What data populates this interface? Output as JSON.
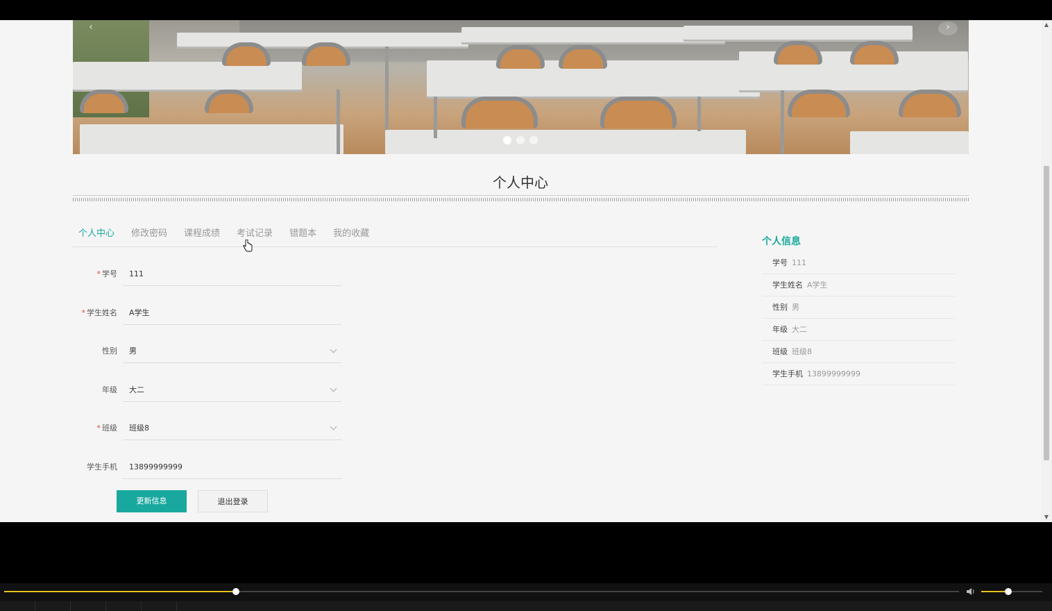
{
  "banner": {
    "prev_arrow": "‹",
    "next_arrow": "›",
    "dots": 3,
    "active_dot": 0
  },
  "page_title": "个人中心",
  "tabs": [
    {
      "label": "个人中心",
      "active": true
    },
    {
      "label": "修改密码",
      "active": false
    },
    {
      "label": "课程成绩",
      "active": false
    },
    {
      "label": "考试记录",
      "active": false
    },
    {
      "label": "错题本",
      "active": false
    },
    {
      "label": "我的收藏",
      "active": false
    }
  ],
  "form": {
    "student_id": {
      "label": "学号",
      "value": "111",
      "required": true
    },
    "student_name": {
      "label": "学生姓名",
      "value": "A学生",
      "required": true
    },
    "gender": {
      "label": "性别",
      "value": "男",
      "required": false
    },
    "grade": {
      "label": "年级",
      "value": "大二",
      "required": false
    },
    "class": {
      "label": "班级",
      "value": "班级8",
      "required": true
    },
    "phone": {
      "label": "学生手机",
      "value": "13899999999",
      "required": false
    }
  },
  "buttons": {
    "update": "更新信息",
    "logout": "退出登录"
  },
  "info": {
    "title": "个人信息",
    "rows": [
      {
        "key": "学号",
        "value": "111"
      },
      {
        "key": "学生姓名",
        "value": "A学生"
      },
      {
        "key": "性别",
        "value": "男"
      },
      {
        "key": "年级",
        "value": "大二"
      },
      {
        "key": "班级",
        "value": "班级8"
      },
      {
        "key": "学生手机",
        "value": "13899999999"
      }
    ]
  },
  "player": {
    "progress": 0.243,
    "volume": 0.44
  },
  "colors": {
    "accent": "#19a89e",
    "required": "#e04a3b",
    "progress": "#e6c21f"
  }
}
